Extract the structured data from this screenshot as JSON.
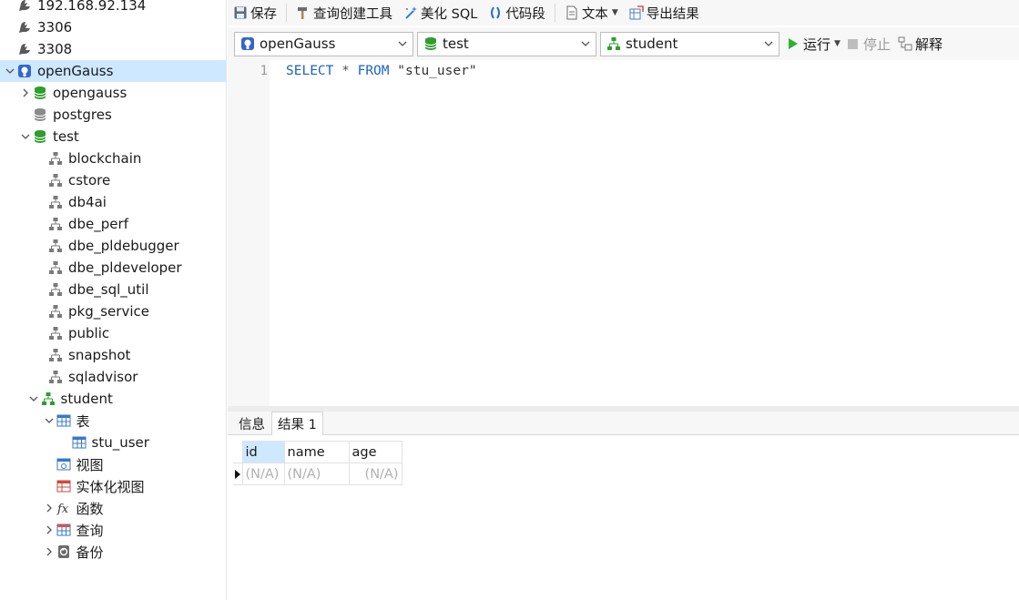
{
  "tree": {
    "items": [
      {
        "label": "192.168.92.134",
        "icon": "mysql-connection-icon",
        "level": 0,
        "arrow": "none"
      },
      {
        "label": "3306",
        "icon": "mysql-connection-icon",
        "level": 0,
        "arrow": "none"
      },
      {
        "label": "3308",
        "icon": "mysql-connection-icon",
        "level": 0,
        "arrow": "none"
      },
      {
        "label": "openGauss",
        "icon": "postgres-connection-icon",
        "level": 0,
        "arrow": "down",
        "selected": true
      },
      {
        "label": "opengauss",
        "icon": "database-open-icon",
        "level": 1,
        "arrow": "right"
      },
      {
        "label": "postgres",
        "icon": "database-closed-icon",
        "level": 1,
        "arrow": "none"
      },
      {
        "label": "test",
        "icon": "database-open-icon",
        "level": 1,
        "arrow": "down"
      },
      {
        "label": "blockchain",
        "icon": "schema-icon",
        "level": 2,
        "arrow": "none"
      },
      {
        "label": "cstore",
        "icon": "schema-icon",
        "level": 2,
        "arrow": "none"
      },
      {
        "label": "db4ai",
        "icon": "schema-icon",
        "level": 2,
        "arrow": "none"
      },
      {
        "label": "dbe_perf",
        "icon": "schema-icon",
        "level": 2,
        "arrow": "none"
      },
      {
        "label": "dbe_pldebugger",
        "icon": "schema-icon",
        "level": 2,
        "arrow": "none"
      },
      {
        "label": "dbe_pldeveloper",
        "icon": "schema-icon",
        "level": 2,
        "arrow": "none"
      },
      {
        "label": "dbe_sql_util",
        "icon": "schema-icon",
        "level": 2,
        "arrow": "none"
      },
      {
        "label": "pkg_service",
        "icon": "schema-icon",
        "level": 2,
        "arrow": "none"
      },
      {
        "label": "public",
        "icon": "schema-icon",
        "level": 2,
        "arrow": "none"
      },
      {
        "label": "snapshot",
        "icon": "schema-icon",
        "level": 2,
        "arrow": "none"
      },
      {
        "label": "sqladvisor",
        "icon": "schema-icon",
        "level": 2,
        "arrow": "none"
      },
      {
        "label": "student",
        "icon": "schema-open-icon",
        "level": 1.5,
        "arrow": "down"
      },
      {
        "label": "表",
        "icon": "table-group-icon",
        "level": 2.5,
        "arrow": "down"
      },
      {
        "label": "stu_user",
        "icon": "table-icon",
        "level": 3.5,
        "arrow": "none"
      },
      {
        "label": "视图",
        "icon": "view-icon",
        "level": 2.5,
        "arrow": "none"
      },
      {
        "label": "实体化视图",
        "icon": "materialized-view-icon",
        "level": 2.5,
        "arrow": "none"
      },
      {
        "label": "函数",
        "icon": "function-icon",
        "level": 2.5,
        "arrow": "right"
      },
      {
        "label": "查询",
        "icon": "query-icon",
        "level": 2.5,
        "arrow": "right"
      },
      {
        "label": "备份",
        "icon": "backup-icon",
        "level": 2.5,
        "arrow": "right"
      }
    ]
  },
  "toolbar": {
    "save": "保存",
    "query_builder": "查询创建工具",
    "beautify": "美化 SQL",
    "snippet": "代码段",
    "text": "文本",
    "export": "导出结果"
  },
  "selectors": {
    "connection": "openGauss",
    "database": "test",
    "schema": "student",
    "run": "运行",
    "stop": "停止",
    "explain": "解释"
  },
  "editor": {
    "line_number": "1",
    "tokens": {
      "k1": "SELECT",
      "op": "*",
      "k2": "FROM",
      "str": "\"stu_user\""
    }
  },
  "results": {
    "tabs": [
      "信息",
      "结果 1"
    ],
    "active_tab": 1,
    "columns": [
      "id",
      "name",
      "age"
    ],
    "row": [
      "(N/A)",
      "(N/A)",
      "(N/A)"
    ]
  },
  "colors": {
    "accent_selected": "#cde8ff",
    "keyword": "#1a62c9",
    "db_green": "#2e9e2e",
    "run_green": "#2fb12f"
  }
}
